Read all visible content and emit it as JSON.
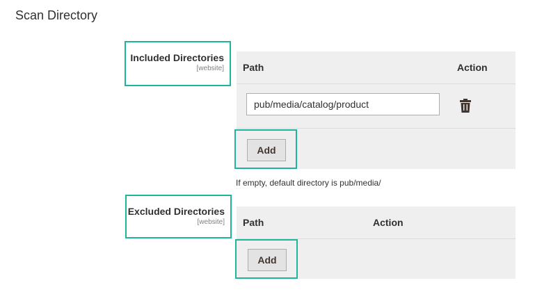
{
  "section": {
    "title": "Scan Directory"
  },
  "included": {
    "label": "Included Directories",
    "scope": "[website]",
    "headers": {
      "path": "Path",
      "action": "Action"
    },
    "rows": [
      {
        "path": "pub/media/catalog/product"
      }
    ],
    "add_label": "Add",
    "note": "If empty, default directory is pub/media/"
  },
  "excluded": {
    "label": "Excluded Directories",
    "scope": "[website]",
    "headers": {
      "path": "Path",
      "action": "Action"
    },
    "add_label": "Add"
  },
  "colors": {
    "highlight": "#1fb59a",
    "grid_bg": "#efefef",
    "button_bg": "#e3e3e3"
  },
  "icons": {
    "delete": "trash-icon"
  }
}
